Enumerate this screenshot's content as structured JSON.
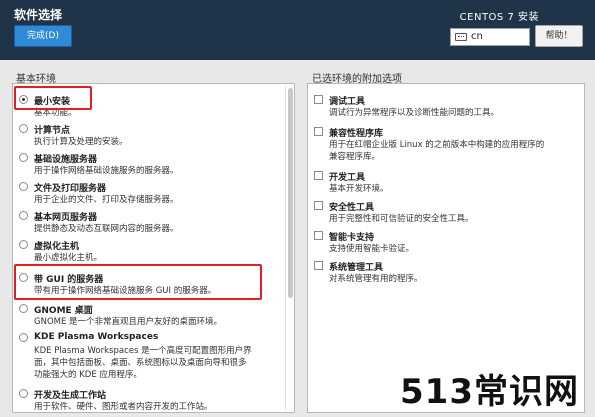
{
  "header": {
    "title": "软件选择",
    "done_label": "完成(D)",
    "product": "CENTOS 7 安装",
    "keyboard_layout": "cn",
    "help_label": "帮助！"
  },
  "left": {
    "heading": "基本环境",
    "items": [
      {
        "title": "最小安装",
        "desc": "基本功能。",
        "checked": true
      },
      {
        "title": "计算节点",
        "desc": "执行计算及处理的安装。"
      },
      {
        "title": "基础设施服务器",
        "desc": "用于操作网络基础设施服务的服务器。"
      },
      {
        "title": "文件及打印服务器",
        "desc": "用于企业的文件、打印及存储服务器。"
      },
      {
        "title": "基本网页服务器",
        "desc": "提供静态及动态互联网内容的服务器。"
      },
      {
        "title": "虚拟化主机",
        "desc": "最小虚拟化主机。"
      },
      {
        "title": "带 GUI 的服务器",
        "desc": "带有用于操作网络基础设施服务 GUI 的服务器。"
      },
      {
        "title": "GNOME 桌面",
        "desc": "GNOME 是一个非常直观且用户友好的桌面环境。"
      },
      {
        "title": "KDE Plasma Workspaces",
        "desc1": "KDE Plasma Workspaces 是一个高度可配置图形用户界",
        "desc2": "面，其中包括面板、桌面、系统图标以及桌面向导和很多",
        "desc3": "功能强大的 KDE 应用程序。"
      },
      {
        "title": "开发及生成工作站",
        "desc": "用于软件、硬件、图形或者内容开发的工作站。"
      }
    ]
  },
  "right": {
    "heading": "已选环境的附加选项",
    "items": [
      {
        "title": "调试工具",
        "desc": "调试行为异常程序以及诊断性能问题的工具。"
      },
      {
        "title": "兼容性程序库",
        "desc1": "用于在红帽企业版 Linux 的之前版本中构建的应用程序的",
        "desc2": "兼容程序库。"
      },
      {
        "title": "开发工具",
        "desc": "基本开发环境。"
      },
      {
        "title": "安全性工具",
        "desc": "用于完整性和可信验证的安全性工具。"
      },
      {
        "title": "智能卡支持",
        "desc": "支持使用智能卡验证。"
      },
      {
        "title": "系统管理工具",
        "desc": "对系统管理有用的程序。"
      }
    ]
  },
  "watermark": "513常识网",
  "colors": {
    "header_bg": "#1f3448",
    "accent": "#2f8ad8",
    "highlight": "#e02020"
  }
}
